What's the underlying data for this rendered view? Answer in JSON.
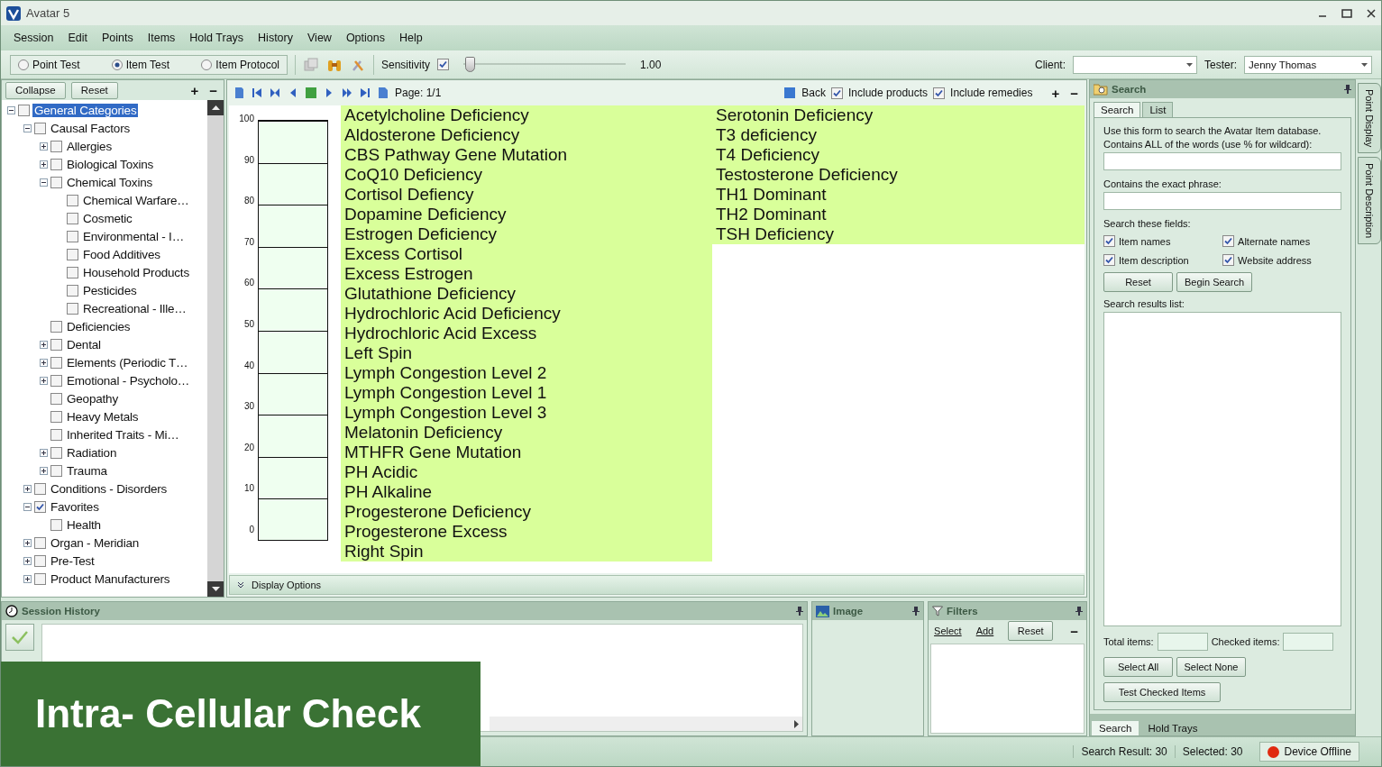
{
  "window": {
    "title": "Avatar 5"
  },
  "menu": [
    "Session",
    "Edit",
    "Points",
    "Items",
    "Hold Trays",
    "History",
    "View",
    "Options",
    "Help"
  ],
  "toolbar": {
    "modes": [
      {
        "label": "Point Test",
        "selected": false
      },
      {
        "label": "Item Test",
        "selected": true
      },
      {
        "label": "Item Protocol",
        "selected": false
      }
    ],
    "sensitivity": {
      "label": "Sensitivity",
      "checked": true,
      "level": 0.04,
      "reading": "1.00"
    },
    "client": {
      "label": "Client:"
    },
    "tester": {
      "label": "Tester:",
      "value": "Jenny Thomas"
    }
  },
  "tree_panel": {
    "buttons": [
      "Collapse",
      "Reset"
    ],
    "add": "+",
    "remove": "−",
    "tree": [
      {
        "label": "General Categories",
        "checked": false,
        "selected": true,
        "expanded": true,
        "children": [
          {
            "label": "Causal Factors",
            "checked": false,
            "selected": false,
            "expanded": true,
            "children": [
              {
                "label": "Allergies",
                "checked": false,
                "selected": false,
                "expanded": false
              },
              {
                "label": "Biological Toxins",
                "checked": false,
                "selected": false,
                "expanded": false
              },
              {
                "label": "Chemical Toxins",
                "checked": false,
                "selected": false,
                "expanded": true,
                "children": [
                  {
                    "label": "Chemical Warfare…",
                    "checked": false,
                    "selected": false
                  },
                  {
                    "label": "Cosmetic",
                    "checked": false,
                    "selected": false
                  },
                  {
                    "label": "Environmental - I…",
                    "checked": false,
                    "selected": false
                  },
                  {
                    "label": "Food Additives",
                    "checked": false,
                    "selected": false
                  },
                  {
                    "label": "Household Products",
                    "checked": false,
                    "selected": false
                  },
                  {
                    "label": "Pesticides",
                    "checked": false,
                    "selected": false
                  },
                  {
                    "label": "Recreational - Ille…",
                    "checked": false,
                    "selected": false
                  }
                ]
              },
              {
                "label": "Deficiencies",
                "checked": false,
                "selected": false
              },
              {
                "label": "Dental",
                "checked": false,
                "selected": false,
                "expanded": false
              },
              {
                "label": "Elements (Periodic T…",
                "checked": false,
                "selected": false,
                "expanded": false
              },
              {
                "label": "Emotional - Psycholo…",
                "checked": false,
                "selected": false,
                "expanded": false
              },
              {
                "label": "Geopathy",
                "checked": false,
                "selected": false
              },
              {
                "label": "Heavy Metals",
                "checked": false,
                "selected": false
              },
              {
                "label": "Inherited Traits - Mi…",
                "checked": false,
                "selected": false
              },
              {
                "label": "Radiation",
                "checked": false,
                "selected": false,
                "expanded": false
              },
              {
                "label": "Trauma",
                "checked": false,
                "selected": false,
                "expanded": false
              }
            ]
          },
          {
            "label": "Conditions - Disorders",
            "checked": false,
            "selected": false,
            "expanded": false
          },
          {
            "label": "Favorites",
            "checked": true,
            "selected": false,
            "expanded": true,
            "children": [
              {
                "label": "Health",
                "checked": false,
                "selected": false
              }
            ]
          },
          {
            "label": "Organ - Meridian",
            "checked": false,
            "selected": false,
            "expanded": false
          },
          {
            "label": "Pre-Test",
            "checked": false,
            "selected": false,
            "expanded": false
          },
          {
            "label": "Product Manufacturers",
            "checked": false,
            "selected": false,
            "expanded": false
          }
        ]
      }
    ]
  },
  "center": {
    "page": "Page: 1/1",
    "back": "Back",
    "include_products": {
      "label": "Include products",
      "checked": true
    },
    "include_remedies": {
      "label": "Include remedies",
      "checked": true
    },
    "zoom_in": "+",
    "zoom_out": "−",
    "gauge": {
      "ticks": [
        "100",
        "90",
        "80",
        "70",
        "60",
        "50",
        "40",
        "30",
        "20",
        "10",
        "0"
      ],
      "level": 0
    },
    "item_columns": [
      [
        "Acetylcholine Deficiency",
        "Aldosterone Deficiency",
        "CBS Pathway Gene Mutation",
        "CoQ10 Deficiency",
        "Cortisol Defiency",
        "Dopamine Deficiency",
        "Estrogen Deficiency",
        "Excess Cortisol",
        "Excess Estrogen",
        "Glutathione Deficiency",
        "Hydrochloric Acid Deficiency",
        "Hydrochloric Acid Excess",
        "Left Spin",
        "Lymph Congestion  Level 2",
        "Lymph Congestion Level 1",
        "Lymph Congestion Level 3",
        "Melatonin Deficiency",
        "MTHFR Gene Mutation",
        "PH Acidic",
        "PH Alkaline",
        "Progesterone Deficiency",
        "Progesterone Excess",
        "Right Spin"
      ],
      [
        "Serotonin Deficiency",
        "T3 deficiency",
        "T4 Deficiency",
        "Testosterone Deficiency",
        "TH1 Dominant",
        "TH2  Dominant",
        "TSH Deficiency"
      ]
    ],
    "display_options": "Display Options"
  },
  "session_history": {
    "title": "Session History"
  },
  "image_panel": {
    "title": "Image"
  },
  "filters": {
    "title": "Filters",
    "links": [
      "Select",
      "Add"
    ],
    "reset": "Reset",
    "collapse": "−"
  },
  "search_panel": {
    "title": "Search",
    "tabs": [
      {
        "label": "Search",
        "selected": true
      },
      {
        "label": "List",
        "selected": false
      }
    ],
    "intro": "Use this form to search the Avatar Item database.",
    "all_words_label": "Contains ALL of the words (use % for wildcard):",
    "phrase_label": "Contains the exact phrase:",
    "fields_label": "Search these fields:",
    "fields": [
      {
        "label": "Item names",
        "checked": true
      },
      {
        "label": "Alternate names",
        "checked": true
      },
      {
        "label": "Item description",
        "checked": true
      },
      {
        "label": "Website address",
        "checked": true
      }
    ],
    "buttons": [
      "Reset",
      "Begin Search"
    ],
    "results_label": "Search results list:",
    "total_label": "Total items:",
    "checked_label": "Checked items:",
    "select_buttons": [
      "Select All",
      "Select None"
    ],
    "test_button": "Test Checked Items",
    "bottom_tabs": [
      {
        "label": "Search",
        "selected": true
      },
      {
        "label": "Hold Trays",
        "selected": false
      }
    ]
  },
  "side_tabs": [
    "Point Display",
    "Point Description"
  ],
  "status_bar": {
    "search_result": "Search Result: 30",
    "selected": "Selected: 30",
    "device": "Device Offline",
    "device_online": false
  },
  "banner": "Intra- Cellular Check"
}
